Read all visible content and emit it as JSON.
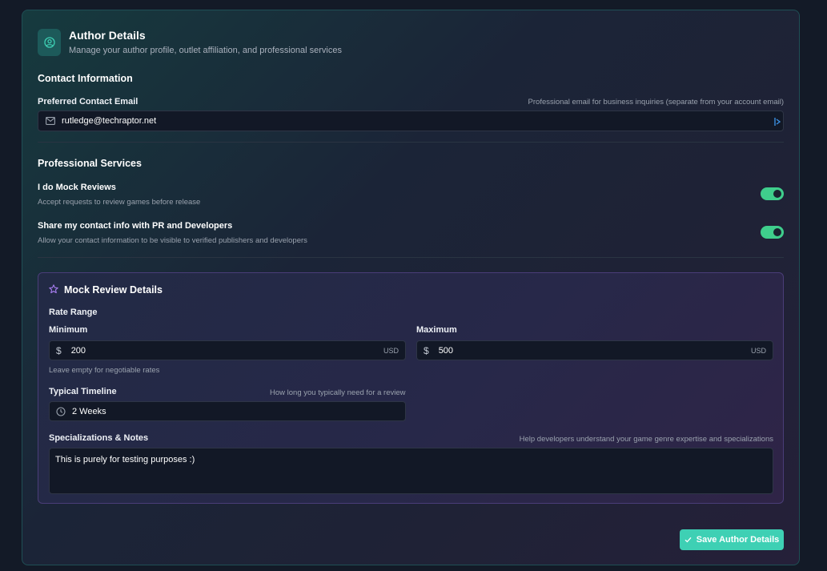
{
  "header": {
    "title": "Author Details",
    "subtitle": "Manage your author profile, outlet affiliation, and professional services",
    "icon": "user-circle-icon"
  },
  "contact": {
    "section_title": "Contact Information",
    "email_label": "Preferred Contact Email",
    "email_hint": "Professional email for business inquiries (separate from your account email)",
    "email_value": "rutledge@techraptor.net",
    "email_icon": "mail-icon"
  },
  "services": {
    "section_title": "Professional Services",
    "items": [
      {
        "title": "I do Mock Reviews",
        "description": "Accept requests to review games before release",
        "enabled": true
      },
      {
        "title": "Share my contact info with PR and Developers",
        "description": "Allow your contact information to be visible to verified publishers and developers",
        "enabled": true
      }
    ]
  },
  "mock_review": {
    "title": "Mock Review Details",
    "icon": "star-icon",
    "rate_range_label": "Rate Range",
    "minimum": {
      "label": "Minimum",
      "currency_symbol": "$",
      "value": "200",
      "unit": "USD"
    },
    "maximum": {
      "label": "Maximum",
      "currency_symbol": "$",
      "value": "500",
      "unit": "USD"
    },
    "rate_hint": "Leave empty for negotiable rates",
    "timeline": {
      "label": "Typical Timeline",
      "hint": "How long you typically need for a review",
      "value": "2 Weeks",
      "icon": "clock-icon"
    },
    "notes": {
      "label": "Specializations & Notes",
      "hint": "Help developers understand your game genre expertise and specializations",
      "value": "This is purely for testing purposes :)"
    }
  },
  "actions": {
    "save_label": "Save Author Details",
    "save_icon": "check-icon"
  },
  "colors": {
    "accent": "#3ed0b4",
    "toggle_on": "#3fce8c",
    "mock_border": "#4a3d78",
    "star": "#a77ef0"
  }
}
